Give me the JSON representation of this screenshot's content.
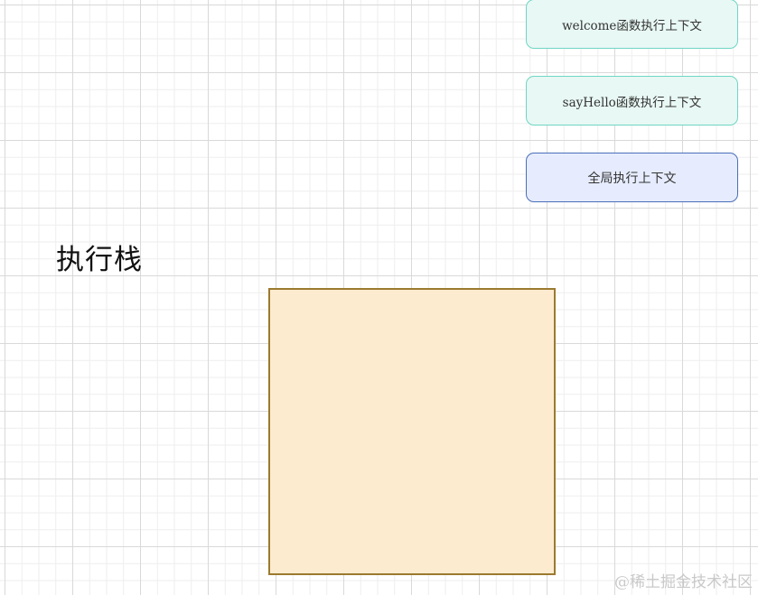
{
  "contexts": [
    {
      "label": "welcome函数执行上下文"
    },
    {
      "label": "sayHello函数执行上下文"
    },
    {
      "label": "全局执行上下文"
    }
  ],
  "stack": {
    "title": "执行栈"
  },
  "watermark": "@稀土掘金技术社区",
  "colors": {
    "function_context_fill": "#e8f8f4",
    "function_context_border": "#6fd6c3",
    "global_context_fill": "#e6ecfd",
    "global_context_border": "#4a6fb8",
    "stack_fill": "#fdebd0",
    "stack_border": "#9b7a2f"
  }
}
